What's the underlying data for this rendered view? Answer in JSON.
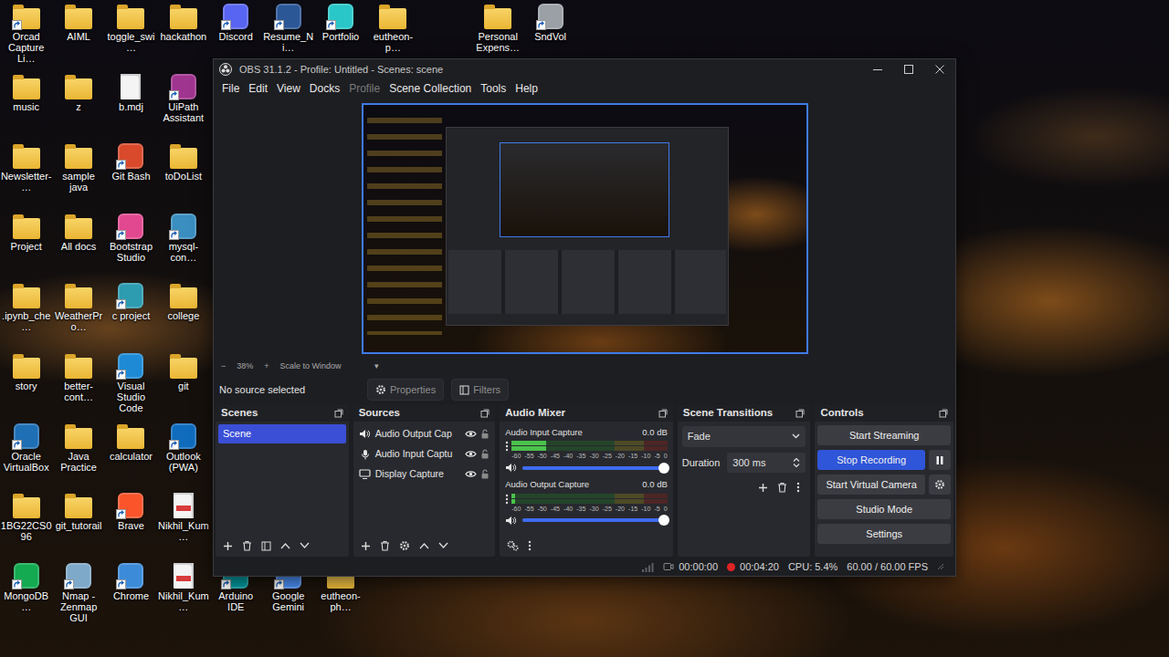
{
  "desktop": {
    "grid_icons": [
      {
        "label": "Orcad Capture Li…",
        "kind": "folder",
        "shortcut": true
      },
      {
        "label": "music",
        "kind": "folder",
        "shortcut": false
      },
      {
        "label": "Newsletter-…",
        "kind": "folder",
        "shortcut": false
      },
      {
        "label": "Project",
        "kind": "folder",
        "shortcut": false
      },
      {
        "label": ".ipynb_che…",
        "kind": "folder",
        "shortcut": false
      },
      {
        "label": "story",
        "kind": "folder",
        "shortcut": false
      },
      {
        "label": "Oracle VirtualBox",
        "kind": "app",
        "color": "#1f6fb5",
        "shortcut": true
      },
      {
        "label": "1BG22CS096",
        "kind": "folder",
        "shortcut": false
      },
      {
        "label": "MongoDB…",
        "kind": "app",
        "color": "#13aa52",
        "shortcut": true
      },
      {
        "label": "AIML",
        "kind": "folder",
        "shortcut": false
      },
      {
        "label": "z",
        "kind": "folder",
        "shortcut": false
      },
      {
        "label": "sample java",
        "kind": "folder",
        "shortcut": false
      },
      {
        "label": "All docs",
        "kind": "folder",
        "shortcut": false
      },
      {
        "label": "WeatherPro…",
        "kind": "folder",
        "shortcut": false
      },
      {
        "label": "better-cont…",
        "kind": "folder",
        "shortcut": false
      },
      {
        "label": "Java Practice",
        "kind": "folder",
        "shortcut": false
      },
      {
        "label": "git_tutorail",
        "kind": "folder",
        "shortcut": false
      },
      {
        "label": "Nmap - Zenmap GUI",
        "kind": "app",
        "color": "#7fa9c9",
        "shortcut": true
      },
      {
        "label": "toggle_swi…",
        "kind": "folder",
        "shortcut": false
      },
      {
        "label": "b.mdj",
        "kind": "file",
        "shortcut": false
      },
      {
        "label": "Git Bash",
        "kind": "app",
        "color": "#d84a2b",
        "shortcut": true
      },
      {
        "label": "Bootstrap Studio",
        "kind": "app",
        "color": "#e2488f",
        "shortcut": true
      },
      {
        "label": "c project",
        "kind": "app",
        "color": "#2d9cb0",
        "shortcut": true
      },
      {
        "label": "Visual Studio Code",
        "kind": "app",
        "color": "#1e8ad6",
        "shortcut": true
      },
      {
        "label": "calculator",
        "kind": "folder",
        "shortcut": false
      },
      {
        "label": "Brave",
        "kind": "app",
        "color": "#fb542b",
        "shortcut": true
      },
      {
        "label": "Chrome",
        "kind": "app",
        "color": "#3c8bd9",
        "shortcut": true
      },
      {
        "label": "hackathon",
        "kind": "folder",
        "shortcut": false
      },
      {
        "label": "UiPath Assistant",
        "kind": "app",
        "color": "#a0358f",
        "shortcut": true
      },
      {
        "label": "toDoList",
        "kind": "folder",
        "shortcut": false
      },
      {
        "label": "mysql-con…",
        "kind": "app",
        "color": "#3a8ec0",
        "shortcut": true
      },
      {
        "label": "college",
        "kind": "folder",
        "shortcut": false
      },
      {
        "label": "git",
        "kind": "folder",
        "shortcut": false
      },
      {
        "label": "Outlook (PWA)",
        "kind": "app",
        "color": "#0f6cbd",
        "shortcut": true
      },
      {
        "label": "Nikhil_Kum…",
        "kind": "pdf",
        "shortcut": false
      },
      {
        "label": "Nikhil_Kum…",
        "kind": "pdf",
        "shortcut": false
      }
    ],
    "top_row_icons": [
      {
        "label": "Discord",
        "kind": "app",
        "color": "#5865f2",
        "shortcut": true
      },
      {
        "label": "Resume_Ni…",
        "kind": "app",
        "color": "#2b5797",
        "shortcut": true
      },
      {
        "label": "Portfolio",
        "kind": "app",
        "color": "#2ac7c8",
        "shortcut": true
      },
      {
        "label": "eutheon-p…",
        "kind": "folder",
        "shortcut": false
      },
      {
        "label": "Personal Expens…",
        "kind": "folder",
        "shortcut": false
      },
      {
        "label": "SndVol",
        "kind": "app",
        "color": "#9aa0a6",
        "shortcut": true
      }
    ],
    "bottom_row_icons": [
      {
        "label": "Arduino IDE",
        "kind": "app",
        "color": "#00979d",
        "shortcut": true
      },
      {
        "label": "Google Gemini",
        "kind": "app",
        "color": "#4a8cf0",
        "shortcut": true
      },
      {
        "label": "eutheon-ph…",
        "kind": "folder",
        "shortcut": false
      }
    ]
  },
  "obs": {
    "title": "OBS 31.1.2 - Profile: Untitled - Scenes: scene",
    "menu": [
      {
        "label": "File",
        "disabled": false
      },
      {
        "label": "Edit",
        "disabled": false
      },
      {
        "label": "View",
        "disabled": false
      },
      {
        "label": "Docks",
        "disabled": false
      },
      {
        "label": "Profile",
        "disabled": true
      },
      {
        "label": "Scene Collection",
        "disabled": false
      },
      {
        "label": "Tools",
        "disabled": false
      },
      {
        "label": "Help",
        "disabled": false
      }
    ],
    "zoom": {
      "minus": "−",
      "value": "38%",
      "plus": "+",
      "mode": "Scale to Window",
      "caret": "▾"
    },
    "source_toolbar": {
      "status": "No source selected",
      "properties": "Properties",
      "filters": "Filters"
    },
    "scenes": {
      "title": "Scenes",
      "items": [
        {
          "label": "Scene",
          "selected": true
        }
      ]
    },
    "sources": {
      "title": "Sources",
      "items": [
        {
          "label": "Audio Output Cap",
          "kind": "audio-output",
          "visible": true,
          "locked": false
        },
        {
          "label": "Audio Input Captu",
          "kind": "audio-input",
          "visible": true,
          "locked": false
        },
        {
          "label": "Display Capture",
          "kind": "display",
          "visible": true,
          "locked": false
        }
      ]
    },
    "audio_mixer": {
      "title": "Audio Mixer",
      "ticks": [
        "-60",
        "-55",
        "-50",
        "-45",
        "-40",
        "-35",
        "-30",
        "-25",
        "-20",
        "-15",
        "-10",
        "-5",
        "0"
      ],
      "channels": [
        {
          "name": "Audio Input Capture",
          "reading": "0.0 dB",
          "muted": false,
          "meter": {
            "level": 0.22
          },
          "volume": {
            "level": 1.0
          }
        },
        {
          "name": "Audio Output Capture",
          "reading": "0.0 dB",
          "muted": false,
          "meter": {
            "level": 0.02
          },
          "volume": {
            "level": 1.0
          }
        }
      ]
    },
    "scene_transitions": {
      "title": "Scene Transitions",
      "transition": "Fade",
      "duration_label": "Duration",
      "duration": "300 ms"
    },
    "controls": {
      "title": "Controls",
      "buttons": [
        {
          "label": "Start Streaming",
          "selected": false,
          "kind": "plain"
        },
        {
          "label": "Stop Recording",
          "selected": true,
          "kind": "pause"
        },
        {
          "label": "Start Virtual Camera",
          "selected": false,
          "kind": "gear"
        },
        {
          "label": "Studio Mode",
          "selected": false,
          "kind": "plain"
        },
        {
          "label": "Settings",
          "selected": false,
          "kind": "plain"
        }
      ]
    },
    "status_bar": {
      "streaming": {
        "time": "00:00:00",
        "active": false
      },
      "recording": {
        "time": "00:04:20",
        "active": true
      },
      "cpu": "CPU: 5.4%",
      "fps": "60.00 / 60.00 FPS"
    }
  }
}
